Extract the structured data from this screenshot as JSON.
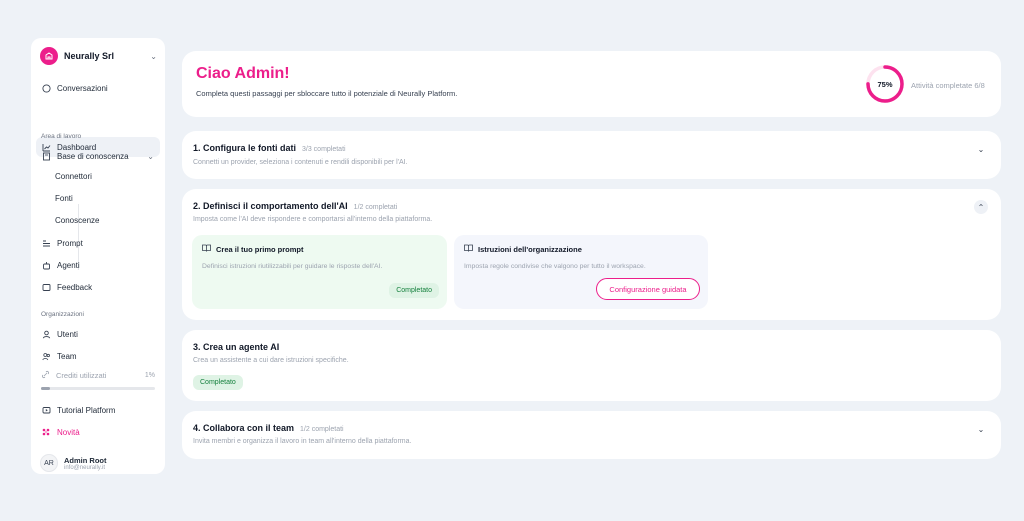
{
  "brand": {
    "name": "Neurally Srl"
  },
  "nav": {
    "conversazioni": "Conversazioni",
    "dashboard": "Dashboard",
    "section_work": "Area di lavoro",
    "base": "Base di conoscenza",
    "connettori": "Connettori",
    "fonti": "Fonti",
    "conoscenze": "Conoscenze",
    "prompt": "Prompt",
    "agenti": "Agenti",
    "feedback": "Feedback",
    "section_org": "Organizzazioni",
    "utenti": "Utenti",
    "team": "Team",
    "crediti": "Crediti utilizzati",
    "crediti_pct": "1%",
    "crediti_value": 0.01,
    "tutorial": "Tutorial Platform",
    "novita": "Novità"
  },
  "user": {
    "initials": "AR",
    "name": "Admin Root",
    "email": "info@neurally.it"
  },
  "hero": {
    "title": "Ciao Admin!",
    "subtitle": "Completa questi passaggi per sbloccare tutto il potenziale di Neurally Platform.",
    "progress_label": "75%",
    "progress_value": 0.75,
    "progress_text": "Attività completate 6/8"
  },
  "steps": [
    {
      "title": "1. Configura le fonti dati",
      "count": "3/3 completati",
      "desc": "Connetti un provider, seleziona i contenuti e rendili disponibili per l'AI."
    },
    {
      "title": "2. Definisci il comportamento dell'AI",
      "count": "1/2 completati",
      "desc": "Imposta come l'AI deve rispondere e comportarsi all'interno della piattaforma.",
      "subs": [
        {
          "title": "Crea il tuo primo prompt",
          "desc": "Definisci istruzioni riutilizzabili per guidare le risposte dell'AI.",
          "status": "Completato"
        },
        {
          "title": "Istruzioni dell'organizzazione",
          "desc": "Imposta regole condivise che valgono per tutto il workspace.",
          "cta": "Configurazione guidata"
        }
      ]
    },
    {
      "title": "3. Crea un agente AI",
      "desc": "Crea un assistente a cui dare istruzioni specifiche.",
      "status": "Completato"
    },
    {
      "title": "4. Collabora con il team",
      "count": "1/2 completati",
      "desc": "Invita membri e organizza il lavoro in team all'interno della piattaforma."
    }
  ],
  "colors": {
    "accent": "#ec1e8b",
    "success": "#15803d",
    "success_bg": "#dff3e5"
  }
}
